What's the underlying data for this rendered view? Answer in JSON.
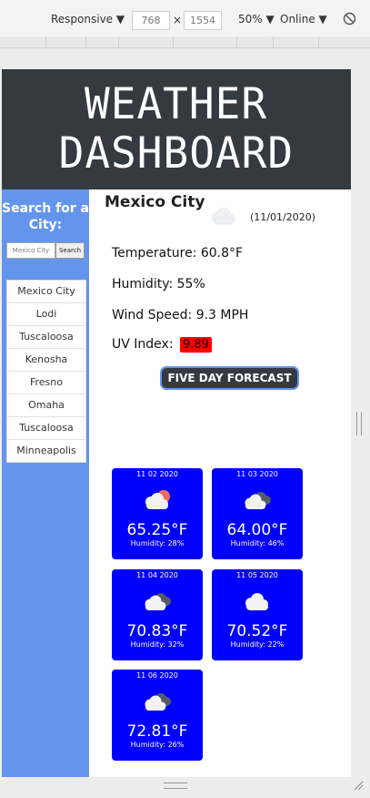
{
  "devtools": {
    "device": "Responsive ▼",
    "width": "768",
    "times": "×",
    "height": "1554",
    "zoom": "50% ▼",
    "network": "Online ▼"
  },
  "header": {
    "line1": "WEATHER",
    "line2": "DASHBOARD"
  },
  "sidebar": {
    "title": "Search for a City:",
    "search_placeholder": "Mexico City",
    "search_button": "Search",
    "cities": [
      "Mexico City",
      "Lodi",
      "Tuscaloosa",
      "Kenosha",
      "Fresno",
      "Omaha",
      "Tuscaloosa",
      "Minneapolis"
    ]
  },
  "current": {
    "city": "Mexico City",
    "date": "(11/01/2020)",
    "icon": "cloud-icon",
    "temperature": "Temperature: 60.8°F",
    "humidity": "Humidity: 55%",
    "wind": "Wind Speed: 9.3 MPH",
    "uv_label": "UV Index:",
    "uv_value": "9.89"
  },
  "forecast_button": "FIVE DAY FORECAST",
  "forecast": [
    {
      "date": "11 02 2020",
      "icon": "cloud-sun-icon",
      "temp": "65.25°F",
      "humidity": "Humidity: 28%"
    },
    {
      "date": "11 03 2020",
      "icon": "clouds-icon",
      "temp": "64.00°F",
      "humidity": "Humidity: 46%"
    },
    {
      "date": "11 04 2020",
      "icon": "clouds-icon",
      "temp": "70.83°F",
      "humidity": "Humidity: 32%"
    },
    {
      "date": "11 05 2020",
      "icon": "cloud-icon",
      "temp": "70.52°F",
      "humidity": "Humidity: 22%"
    },
    {
      "date": "11 06 2020",
      "icon": "clouds-icon",
      "temp": "72.81°F",
      "humidity": "Humidity: 26%"
    }
  ],
  "colors": {
    "header": "#353a40",
    "sidebar": "#6495ed",
    "card": "#0000ff",
    "uv": "#ff0000"
  }
}
